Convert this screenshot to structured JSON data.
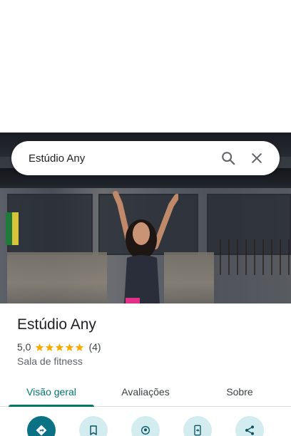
{
  "search": {
    "query": "Estúdio Any"
  },
  "place": {
    "name": "Estúdio Any",
    "rating": "5,0",
    "rating_value": 5,
    "reviews_count": "(4)",
    "category": "Sala de fitness"
  },
  "tabs": [
    {
      "label": "Visão geral",
      "active": true
    },
    {
      "label": "Avaliações",
      "active": false
    },
    {
      "label": "Sobre",
      "active": false
    }
  ],
  "actions": [
    {
      "icon": "directions-icon"
    },
    {
      "icon": "bookmark-icon"
    },
    {
      "icon": "nearby-pin-icon"
    },
    {
      "icon": "send-to-phone-icon"
    },
    {
      "icon": "share-icon"
    }
  ],
  "colors": {
    "accent": "#00796b",
    "star": "#f9ab00",
    "action_bg": "#d2ecef",
    "primary_action": "#0b7285"
  }
}
